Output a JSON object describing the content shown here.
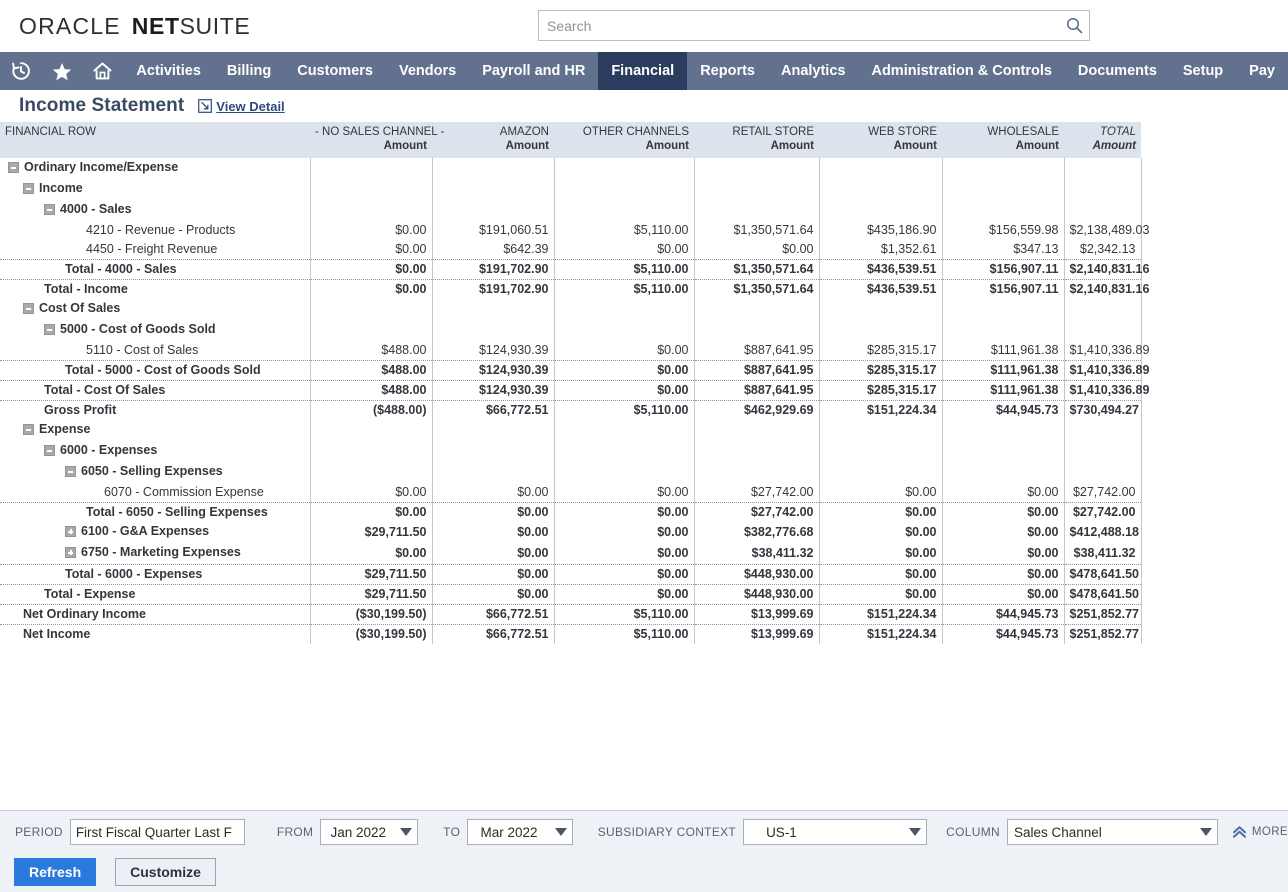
{
  "header": {
    "brand_oracle": "ORACLE",
    "brand_net": "NET",
    "brand_suite": "SUITE",
    "search_placeholder": "Search",
    "search_value": ""
  },
  "nav": {
    "icons": [
      {
        "name": "recent-history-icon",
        "label": "Recent Records"
      },
      {
        "name": "favorites-star-icon",
        "label": "Shortcuts"
      },
      {
        "name": "home-icon",
        "label": "Home"
      }
    ],
    "items": [
      {
        "label": "Activities",
        "active": false
      },
      {
        "label": "Billing",
        "active": false
      },
      {
        "label": "Customers",
        "active": false
      },
      {
        "label": "Vendors",
        "active": false
      },
      {
        "label": "Payroll and HR",
        "active": false
      },
      {
        "label": "Financial",
        "active": true
      },
      {
        "label": "Reports",
        "active": false
      },
      {
        "label": "Analytics",
        "active": false
      },
      {
        "label": "Administration & Controls",
        "active": false
      },
      {
        "label": "Documents",
        "active": false
      },
      {
        "label": "Setup",
        "active": false
      },
      {
        "label": "Pay",
        "active": false
      }
    ]
  },
  "page": {
    "title": "Income Statement",
    "view_detail_label": "View Detail"
  },
  "report": {
    "row_header": "FINANCIAL ROW",
    "amount_label": "Amount",
    "columns": [
      {
        "name": "- NO SALES CHANNEL -",
        "sub": "Amount",
        "italic": false
      },
      {
        "name": "AMAZON",
        "sub": "Amount",
        "italic": false
      },
      {
        "name": "OTHER CHANNELS",
        "sub": "Amount",
        "italic": false
      },
      {
        "name": "RETAIL STORE",
        "sub": "Amount",
        "italic": false
      },
      {
        "name": "WEB STORE",
        "sub": "Amount",
        "italic": false
      },
      {
        "name": "WHOLESALE",
        "sub": "Amount",
        "italic": false
      },
      {
        "name": "TOTAL",
        "sub": "Amount",
        "italic": true
      }
    ],
    "rows": [
      {
        "label": "Ordinary Income/Expense",
        "indent": 0,
        "toggle": "minus",
        "bold": true,
        "values": [
          "",
          "",
          "",
          "",
          "",
          "",
          ""
        ]
      },
      {
        "label": "Income",
        "indent": 1,
        "toggle": "minus",
        "bold": true,
        "values": [
          "",
          "",
          "",
          "",
          "",
          "",
          ""
        ]
      },
      {
        "label": "4000 - Sales",
        "indent": 2,
        "toggle": "minus",
        "bold": true,
        "values": [
          "",
          "",
          "",
          "",
          "",
          "",
          ""
        ]
      },
      {
        "label": "4210 - Revenue - Products",
        "indent": 4,
        "toggle": "none",
        "bold": false,
        "values": [
          "$0.00",
          "$191,060.51",
          "$5,110.00",
          "$1,350,571.64",
          "$435,186.90",
          "$156,559.98",
          "$2,138,489.03"
        ]
      },
      {
        "label": "4450 - Freight Revenue",
        "indent": 4,
        "toggle": "none",
        "bold": false,
        "values": [
          "$0.00",
          "$642.39",
          "$0.00",
          "$0.00",
          "$1,352.61",
          "$347.13",
          "$2,342.13"
        ]
      },
      {
        "label": "Total - 4000 - Sales",
        "indent": 3,
        "toggle": "none",
        "bold": true,
        "topline": true,
        "botline": true,
        "values": [
          "$0.00",
          "$191,702.90",
          "$5,110.00",
          "$1,350,571.64",
          "$436,539.51",
          "$156,907.11",
          "$2,140,831.16"
        ]
      },
      {
        "label": "Total - Income",
        "indent": 2,
        "toggle": "none",
        "bold": true,
        "values": [
          "$0.00",
          "$191,702.90",
          "$5,110.00",
          "$1,350,571.64",
          "$436,539.51",
          "$156,907.11",
          "$2,140,831.16"
        ]
      },
      {
        "label": "Cost Of Sales",
        "indent": 1,
        "toggle": "minus",
        "bold": true,
        "values": [
          "",
          "",
          "",
          "",
          "",
          "",
          ""
        ]
      },
      {
        "label": "5000 - Cost of Goods Sold",
        "indent": 2,
        "toggle": "minus",
        "bold": true,
        "values": [
          "",
          "",
          "",
          "",
          "",
          "",
          ""
        ]
      },
      {
        "label": "5110 - Cost of Sales",
        "indent": 4,
        "toggle": "none",
        "bold": false,
        "values": [
          "$488.00",
          "$124,930.39",
          "$0.00",
          "$887,641.95",
          "$285,315.17",
          "$111,961.38",
          "$1,410,336.89"
        ]
      },
      {
        "label": "Total - 5000 - Cost of Goods Sold",
        "indent": 3,
        "toggle": "none",
        "bold": true,
        "topline": true,
        "values": [
          "$488.00",
          "$124,930.39",
          "$0.00",
          "$887,641.95",
          "$285,315.17",
          "$111,961.38",
          "$1,410,336.89"
        ]
      },
      {
        "label": "Total - Cost Of Sales",
        "indent": 2,
        "toggle": "none",
        "bold": true,
        "topline": true,
        "values": [
          "$488.00",
          "$124,930.39",
          "$0.00",
          "$887,641.95",
          "$285,315.17",
          "$111,961.38",
          "$1,410,336.89"
        ]
      },
      {
        "label": "Gross Profit",
        "indent": 2,
        "toggle": "none",
        "bold": true,
        "topline": true,
        "values": [
          "($488.00)",
          "$66,772.51",
          "$5,110.00",
          "$462,929.69",
          "$151,224.34",
          "$44,945.73",
          "$730,494.27"
        ]
      },
      {
        "label": "Expense",
        "indent": 1,
        "toggle": "minus",
        "bold": true,
        "values": [
          "",
          "",
          "",
          "",
          "",
          "",
          ""
        ]
      },
      {
        "label": "6000 - Expenses",
        "indent": 2,
        "toggle": "minus",
        "bold": true,
        "values": [
          "",
          "",
          "",
          "",
          "",
          "",
          ""
        ]
      },
      {
        "label": "6050 - Selling Expenses",
        "indent": 3,
        "toggle": "minus",
        "bold": true,
        "values": [
          "",
          "",
          "",
          "",
          "",
          "",
          ""
        ]
      },
      {
        "label": "6070 - Commission Expense",
        "indent": 5,
        "toggle": "none",
        "bold": false,
        "values": [
          "$0.00",
          "$0.00",
          "$0.00",
          "$27,742.00",
          "$0.00",
          "$0.00",
          "$27,742.00"
        ]
      },
      {
        "label": "Total - 6050 - Selling Expenses",
        "indent": 4,
        "toggle": "none",
        "bold": true,
        "topline": true,
        "values": [
          "$0.00",
          "$0.00",
          "$0.00",
          "$27,742.00",
          "$0.00",
          "$0.00",
          "$27,742.00"
        ]
      },
      {
        "label": "6100 - G&A Expenses",
        "indent": 3,
        "toggle": "plus",
        "bold": true,
        "values": [
          "$29,711.50",
          "$0.00",
          "$0.00",
          "$382,776.68",
          "$0.00",
          "$0.00",
          "$412,488.18"
        ]
      },
      {
        "label": "6750 - Marketing Expenses",
        "indent": 3,
        "toggle": "plus",
        "bold": true,
        "values": [
          "$0.00",
          "$0.00",
          "$0.00",
          "$38,411.32",
          "$0.00",
          "$0.00",
          "$38,411.32"
        ]
      },
      {
        "label": "Total - 6000 - Expenses",
        "indent": 3,
        "toggle": "none",
        "bold": true,
        "topline": true,
        "values": [
          "$29,711.50",
          "$0.00",
          "$0.00",
          "$448,930.00",
          "$0.00",
          "$0.00",
          "$478,641.50"
        ]
      },
      {
        "label": "Total - Expense",
        "indent": 2,
        "toggle": "none",
        "bold": true,
        "topline": true,
        "values": [
          "$29,711.50",
          "$0.00",
          "$0.00",
          "$448,930.00",
          "$0.00",
          "$0.00",
          "$478,641.50"
        ]
      },
      {
        "label": "Net Ordinary Income",
        "indent": 1,
        "toggle": "none",
        "bold": true,
        "topline": true,
        "values": [
          "($30,199.50)",
          "$66,772.51",
          "$5,110.00",
          "$13,999.69",
          "$151,224.34",
          "$44,945.73",
          "$251,852.77"
        ]
      },
      {
        "label": "Net Income",
        "indent": 1,
        "toggle": "none",
        "bold": true,
        "topline": true,
        "values": [
          "($30,199.50)",
          "$66,772.51",
          "$5,110.00",
          "$13,999.69",
          "$151,224.34",
          "$44,945.73",
          "$251,852.77"
        ]
      }
    ]
  },
  "footer": {
    "period_label": "PERIOD",
    "period_value": "First Fiscal Quarter Last F",
    "from_label": "FROM",
    "from_value": "Jan 2022",
    "to_label": "TO",
    "to_value": "Mar 2022",
    "subsidiary_label": "SUBSIDIARY CONTEXT",
    "subsidiary_value": "US-1",
    "column_label": "COLUMN",
    "column_value": "Sales Channel",
    "more_label": "MORE",
    "refresh_label": "Refresh",
    "customize_label": "Customize"
  },
  "colors": {
    "nav_bg": "#62718e",
    "nav_active": "#2b3c5e",
    "header_bg": "#dde3ec",
    "title_color": "#3b4a63",
    "primary_button": "#2a7ade",
    "footer_bg": "#eef1f5"
  }
}
